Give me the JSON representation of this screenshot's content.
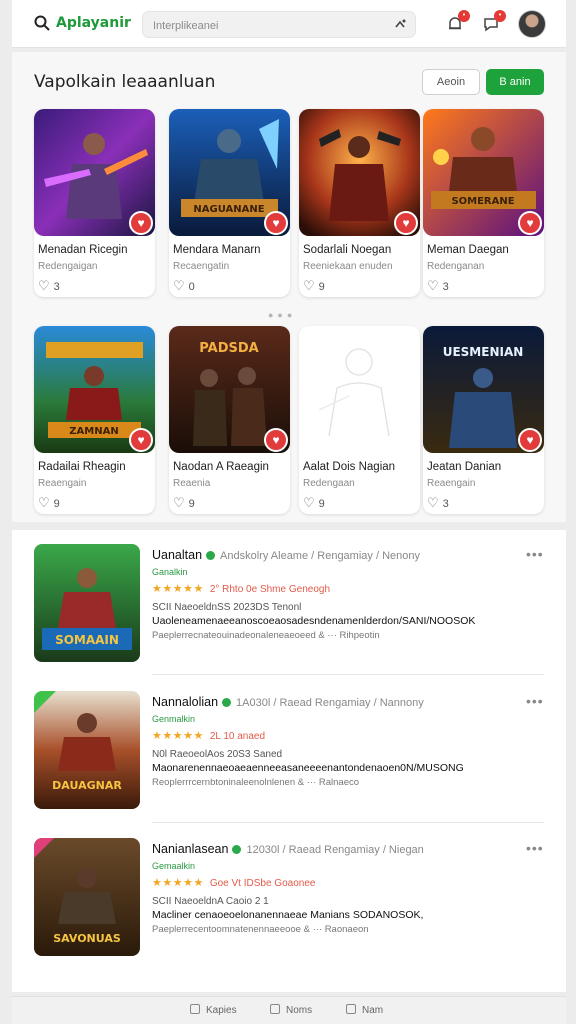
{
  "header": {
    "logo": "Aplayanir",
    "search_placeholder": "Interplikeanei"
  },
  "featured": {
    "title": "Vapolkain leaaanluan",
    "btn_secondary": "Aeoin",
    "btn_primary": "B anin",
    "cards": [
      {
        "title": "Menadan Ricegin",
        "subtitle": "Redengaigan",
        "likes": "3",
        "badge_art": ""
      },
      {
        "title": "Mendara Manarn",
        "subtitle": "Recaengatin",
        "likes": "0",
        "badge_art": "NAGUANANE"
      },
      {
        "title": "Sodarlali Noegan",
        "subtitle": "Reeniekaan enuden",
        "likes": "9",
        "badge_art": ""
      },
      {
        "title": "Meman Daegan",
        "subtitle": "Redenganan",
        "likes": "3",
        "badge_art": "SOMERANE"
      },
      {
        "title": "Radailai Rheagin",
        "subtitle": "Reaengain",
        "likes": "9",
        "badge_art": "ZAMNAN"
      },
      {
        "title": "Naodan A Raeagin",
        "subtitle": "Reaenia",
        "likes": "9",
        "badge_art": "PADSDA"
      },
      {
        "title": "Aalat Dois Nagian",
        "subtitle": "Redengaan",
        "likes": "9",
        "badge_art": ""
      },
      {
        "title": "Jeatan Danian",
        "subtitle": "Reaengain",
        "likes": "3",
        "badge_art": "UESMENIAN"
      }
    ]
  },
  "list": [
    {
      "name": "Uanaltan",
      "meta": "Andskolry Aleame / Rengamiay / Nenony",
      "tag": "Ganalkin",
      "rating_text": "2°  Rhto 0e Shme Geneogh",
      "line1": "SCII NaeoeldnSS 2023DS Tenonl",
      "line2": "Uaoleneamenaeeanoscoeaosadesndenamenlderdon/SANI/NOOSOK",
      "line3": "Paeplerrecnateouinadeonaleneaeoeed & ···  Rihpeotin",
      "art_label": "SOMAAIN"
    },
    {
      "name": "Nannalolian",
      "meta": "1A030l / Raead Rengamiay / Nannony",
      "tag": "Genmalkin",
      "rating_text": "2L  10 anaed",
      "line1": "N0l RaeoeolAos 20S3 Saned",
      "line2": "Maonarenennaeoaeaenneeasaneeeenantondenaoen0N/MUSONG",
      "line3": "Reoplerrrcernbtoninaleenolnlenen & ···  Ralnaeco",
      "art_label": "DAUAGNAR"
    },
    {
      "name": "Nanianlasean",
      "meta": "12030l / Raead Rengamiay / Niegan",
      "tag": "Gemaalkin",
      "rating_text": "Goe  Vt  IDSbe Goaonee",
      "line1": "SCII NaeoeldnA Caoio 2 1",
      "line2": "Macliner cenaoeoelonanennaeae Manians SODANOSOK,",
      "line3": "Paeplerrecentoomnatenennaeeooe & ···  Raonaeon",
      "art_label": "SAVONUAS"
    }
  ],
  "footer": {
    "item1": "Kapies",
    "item2": "Noms",
    "item3": "Nam"
  },
  "colors": {
    "brand_green": "#1ea23c",
    "heart_red": "#e23b3b",
    "star": "#f2a623"
  }
}
